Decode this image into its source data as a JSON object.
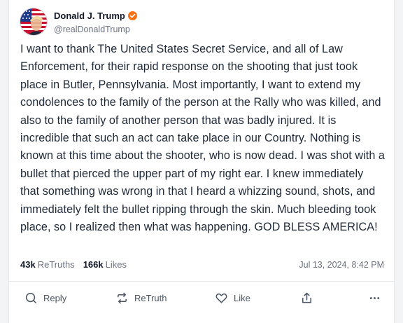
{
  "author": {
    "display_name": "Donald J. Trump",
    "handle": "@realDonaldTrump",
    "verified_icon": "verified-badge-icon",
    "avatar_icon": "avatar-image"
  },
  "post": {
    "text": "I want to thank The United States Secret Service, and all of Law Enforcement, for their rapid response on the shooting that just took place in Butler, Pennsylvania. Most importantly, I want to extend my condolences to the family of the person at the Rally who was killed, and also to the family of another person that was badly injured. It is incredible that such an act can take place in our Country. Nothing is known at this time about the shooter, who is now dead. I was shot with a bullet that pierced the upper part of my right ear. I knew immediately that something was wrong in that I heard a whizzing sound, shots, and immediately felt the bullet ripping through the skin. Much bleeding took place, so I realized then what was happening. GOD BLESS AMERICA!"
  },
  "stats": {
    "retruths_count": "43k",
    "retruths_label": "ReTruths",
    "likes_count": "166k",
    "likes_label": "Likes",
    "timestamp": "Jul 13, 2024, 8:42 PM"
  },
  "actions": {
    "reply_label": "Reply",
    "retruth_label": "ReTruth",
    "like_label": "Like",
    "icons": [
      "reply-icon",
      "retruth-icon",
      "like-icon",
      "share-icon",
      "more-icon"
    ]
  },
  "colors": {
    "accent_verified": "#f97316",
    "text_primary": "#111827",
    "text_secondary": "#6b7280"
  }
}
